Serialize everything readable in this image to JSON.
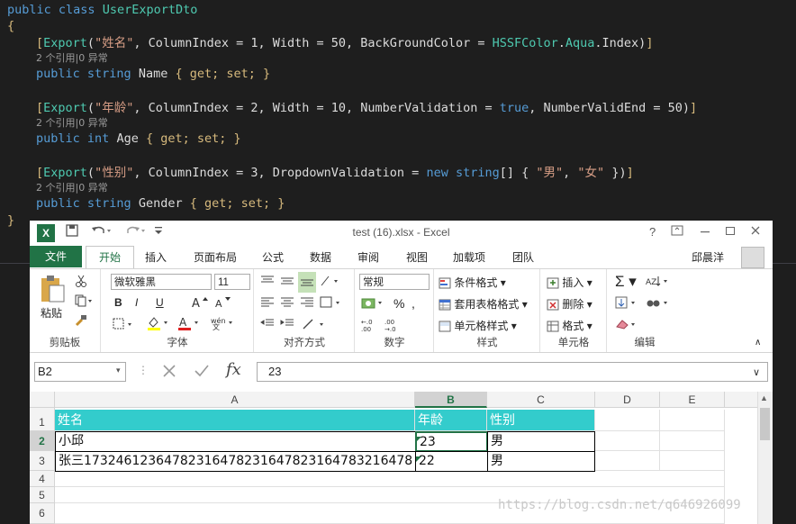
{
  "code": {
    "class_decl": {
      "kw1": "public",
      "kw2": "class",
      "name": "UserExportDto"
    },
    "open_brace": "{",
    "close_brace": "}",
    "attr1": {
      "open": "[",
      "attr": "Export",
      "args_pre": "(",
      "str": "\"姓名\"",
      "mid": ", ColumnIndex = 1, Width = 50, BackGroundColor = ",
      "type": "HSSFColor",
      "dot": ".",
      "sub": "Aqua",
      "end": ".Index)",
      "close": "]"
    },
    "refs1": "2 个引用|0 异常",
    "prop1": {
      "kw": "public",
      "type": "string",
      "name": " Name ",
      "rest": "{ get; set; }"
    },
    "attr2": {
      "open": "[",
      "attr": "Export",
      "args_pre": "(",
      "str": "\"年龄\"",
      "mid": ", ColumnIndex = 2, Width = 10, NumberValidation = ",
      "kw": "true",
      "end": ", NumberValidEnd = 50)",
      "close": "]"
    },
    "refs2": "2 个引用|0 异常",
    "prop2": {
      "kw": "public",
      "type": "int",
      "name": " Age ",
      "rest": "{ get; set; }"
    },
    "attr3": {
      "open": "[",
      "attr": "Export",
      "args_pre": "(",
      "str": "\"性别\"",
      "mid": ", ColumnIndex = 3, DropdownValidation = ",
      "kw": "new",
      "type": "string",
      "arr": "[] { ",
      "s1": "\"男\"",
      "comma": ", ",
      "s2": "\"女\"",
      "end": " })",
      "close": "]"
    },
    "refs3": "2 个引用|0 异常",
    "prop3": {
      "kw": "public",
      "type": "string",
      "name": " Gender ",
      "rest": "{ get; set; }"
    }
  },
  "excel": {
    "logo": "X",
    "window_title": "test (16).xlsx - Excel",
    "help": "?",
    "tabs": {
      "file": "文件",
      "home": "开始",
      "insert": "插入",
      "layout": "页面布局",
      "formulas": "公式",
      "data": "数据",
      "review": "审阅",
      "view": "视图",
      "addins": "加载项",
      "team": "团队"
    },
    "user": "邱晨洋",
    "ribbon": {
      "paste": "粘贴",
      "clipboard": "剪贴板",
      "font_name": "微软雅黑",
      "font_size": "11",
      "font": "字体",
      "bold": "B",
      "italic": "I",
      "underline": "U",
      "alignment": "对齐方式",
      "number_format": "常规",
      "number": "数字",
      "cond_format": "条件格式",
      "table_format": "套用表格格式",
      "cell_style": "单元格样式",
      "styles": "样式",
      "insert": "插入",
      "delete": "删除",
      "format": "格式",
      "cells": "单元格",
      "editing": "编辑"
    },
    "name_box": "B2",
    "fx": "fx",
    "formula_value": "23",
    "columns": [
      "A",
      "B",
      "C",
      "D",
      "E"
    ],
    "rows": [
      "1",
      "2",
      "3",
      "4",
      "5",
      "6"
    ],
    "cells": {
      "a1": "姓名",
      "b1": "年龄",
      "c1": "性别",
      "a2": "小邱",
      "b2": "23",
      "c2": "男",
      "a3": "张三17324612364782316478231647823164783216478",
      "b3": "22",
      "c3": "男"
    }
  },
  "watermark": "https://blog.csdn.net/q646926099"
}
